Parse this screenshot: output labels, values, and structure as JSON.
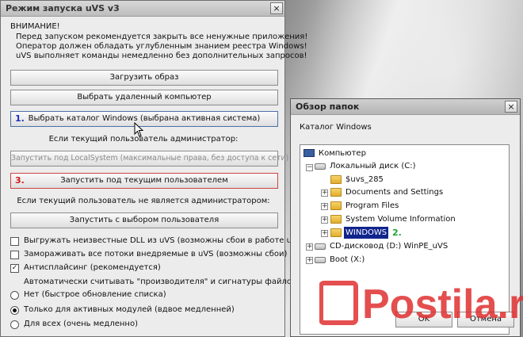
{
  "main": {
    "title": "Режим запуска uVS v3",
    "close": "×",
    "warning_title": "ВНИМАНИЕ!",
    "warning_lines": [
      "Перед запуском рекомендуется закрыть все ненужные приложения!",
      "Оператор должен обладать углубленным знанием реестра Windows!",
      "uVS выполняет команды немедленно без дополнительных запросов!"
    ],
    "btn_load_image": "Загрузить образ",
    "btn_remote": "Выбрать удаленный компьютер",
    "btn_select_dir_num": "1.",
    "btn_select_dir": "Выбрать каталог Windows (выбрана активная система)",
    "admin_label": "Если текущий пользователь администратор:",
    "btn_localsystem": "Запустить под LocalSystem (максимальные права, без доступа к сети)",
    "btn_current_num": "3.",
    "btn_current_user": "Запустить под текущим пользователем",
    "nonadmin_label": "Если текущий пользователь не является администратором:",
    "btn_choose_user": "Запустить с выбором пользователя",
    "checkboxes": [
      {
        "label": "Выгружать неизвестные DLL из uVS (возможны сбои в работе uvs)",
        "checked": false
      },
      {
        "label": "Замораживать все потоки внедряемые в uVS (возможны сбои)",
        "checked": false
      },
      {
        "label": "Антисплайсинг (рекомендуется)",
        "checked": true
      }
    ],
    "auto_read_label": "Автоматически считывать \"производителя\" и сигнатуры файлов:",
    "radios": [
      {
        "label": "Нет (быстрое обновление списка)",
        "checked": false
      },
      {
        "label": "Только для активных модулей (вдвое медленней)",
        "checked": true
      },
      {
        "label": "Для всех (очень медленно)",
        "checked": false
      }
    ]
  },
  "browse": {
    "title": "Обзор папок",
    "close": "×",
    "caption": "Каталог Windows",
    "tree": {
      "computer": "Компьютер",
      "drive_c": "Локальный диск (C:)",
      "uvs": "$uvs_285",
      "docs": "Documents and Settings",
      "program_files": "Program Files",
      "svi": "System Volume Information",
      "windows": "WINDOWS",
      "windows_num": "2.",
      "cd": "CD-дисковод (D:) WinPE_uVS",
      "boot": "Boot (X:)"
    },
    "ok": "OK",
    "cancel": "Отмена"
  },
  "watermark": {
    "text": "Postila.ru"
  },
  "colors": {
    "selection": "#10248c",
    "num_blue": "#1b2dc0",
    "num_red": "#d21a1a",
    "watermark": "#e03030"
  }
}
